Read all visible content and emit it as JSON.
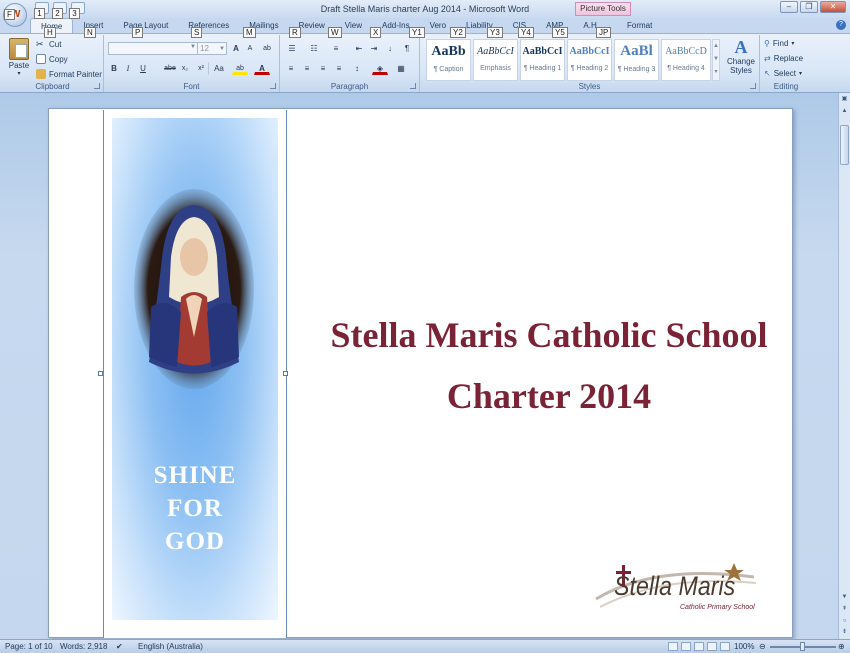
{
  "window": {
    "title": "Draft Stella Maris charter Aug 2014  -  Microsoft Word",
    "context_tab": "Picture Tools",
    "office_button_keytip": "F",
    "qat_keytips": [
      "1",
      "2",
      "3"
    ],
    "controls": {
      "minimize": "–",
      "restore": "❐",
      "close": "✕"
    }
  },
  "tabs": [
    {
      "label": "Home",
      "keytip": "H"
    },
    {
      "label": "Insert",
      "keytip": "N"
    },
    {
      "label": "Page Layout",
      "keytip": "P"
    },
    {
      "label": "References",
      "keytip": "S"
    },
    {
      "label": "Mailings",
      "keytip": "M"
    },
    {
      "label": "Review",
      "keytip": "R"
    },
    {
      "label": "View",
      "keytip": "W"
    },
    {
      "label": "Add-Ins",
      "keytip": "X"
    },
    {
      "label": "Vero",
      "keytip": "Y1"
    },
    {
      "label": "Liability",
      "keytip": "Y2"
    },
    {
      "label": "CIS",
      "keytip": "Y3"
    },
    {
      "label": "AMP",
      "keytip": "Y4"
    },
    {
      "label": "A.H.",
      "keytip": "Y5"
    },
    {
      "label": "Format",
      "keytip": "JP"
    }
  ],
  "help_icon": "?",
  "clipboard": {
    "label": "Clipboard",
    "paste": "Paste",
    "cut": "Cut",
    "copy": "Copy",
    "format_painter": "Format Painter"
  },
  "font": {
    "label": "Font",
    "font_name": "",
    "font_size": "12",
    "grow": "A",
    "shrink": "A",
    "clear": "ab",
    "bold": "B",
    "italic": "I",
    "underline": "U",
    "strike": "abe",
    "subscript": "x₂",
    "superscript": "x²",
    "change_case": "Aa",
    "highlight": "ab",
    "font_color": "A"
  },
  "paragraph": {
    "label": "Paragraph",
    "show_marks": "¶"
  },
  "styles": {
    "label": "Styles",
    "items": [
      {
        "preview": "AaBb",
        "name": "¶ Caption"
      },
      {
        "preview": "AaBbCcI",
        "name": "Emphasis"
      },
      {
        "preview": "AaBbCcI",
        "name": "¶ Heading 1"
      },
      {
        "preview": "AaBbCcI",
        "name": "¶ Heading 2"
      },
      {
        "preview": "AaBl",
        "name": "¶ Heading 3"
      },
      {
        "preview": "AaBbCcD",
        "name": "¶ Heading 4"
      }
    ],
    "change_styles": "Change Styles"
  },
  "editing": {
    "label": "Editing",
    "find": "Find",
    "replace": "Replace",
    "select": "Select"
  },
  "document": {
    "motto": [
      "SHINE",
      "FOR",
      "GOD"
    ],
    "title_line1": "Stella Maris Catholic School",
    "title_line2": "Charter 2014",
    "logo_text": "Stella Maris",
    "logo_subtitle": "Catholic Primary School"
  },
  "status": {
    "page": "Page: 1 of 10",
    "words": "Words: 2,918",
    "language": "English (Australia)",
    "zoom": "100%"
  },
  "colors": {
    "title": "#7b2336",
    "banner_blue": "#64a8ee"
  }
}
